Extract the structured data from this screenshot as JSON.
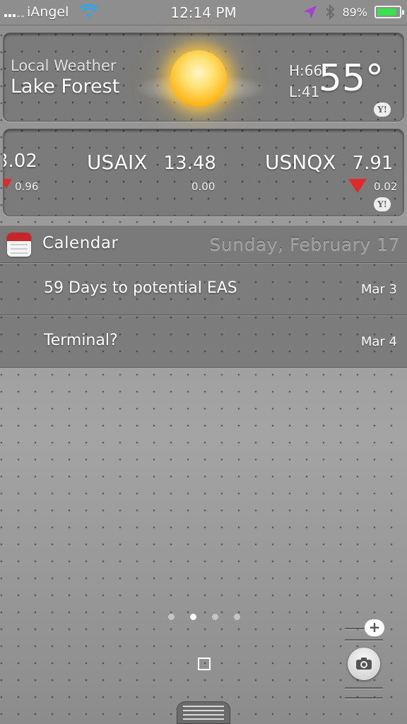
{
  "status_bar": {
    "carrier": "iAngel",
    "time": "12:14 PM",
    "battery_percent": "89%",
    "battery_level": 0.89,
    "icons": [
      "signal-icon",
      "wifi-icon",
      "location-icon",
      "bluetooth-icon",
      "battery-icon"
    ],
    "battery_color": "#39e14a"
  },
  "weather": {
    "label": "Local Weather",
    "city": "Lake Forest",
    "high": "H:66°",
    "low": "L:41°",
    "temp": "55°",
    "condition_icon": "sun-with-clouds-icon",
    "provider_badge": "Y!"
  },
  "stocks": {
    "items": [
      {
        "symbol": "",
        "price": "3.02",
        "change": "0.96",
        "direction": "down"
      },
      {
        "symbol": "USAIX",
        "price": "13.48",
        "change": "0.00",
        "direction": "none"
      },
      {
        "symbol": "USNQX",
        "price": "7.91",
        "change": "0.02",
        "direction": "down"
      }
    ],
    "provider_badge": "Y!",
    "down_color": "#e02a2a"
  },
  "calendar": {
    "title": "Calendar",
    "date": "Sunday, February 17",
    "events": [
      {
        "title": "59 Days to potential EAS",
        "date": "Mar 3"
      },
      {
        "title": "Terminal?",
        "date": "Mar 4"
      }
    ]
  },
  "pager": {
    "pages": 4,
    "active_index": 1
  }
}
